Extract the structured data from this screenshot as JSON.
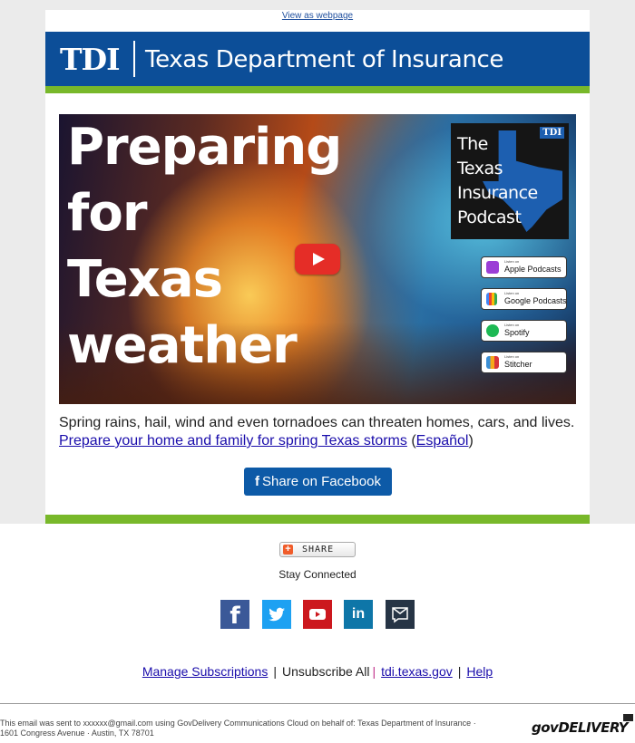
{
  "header": {
    "view_as_webpage": "View as webpage",
    "logo_text": "TDI",
    "org_name": "Texas Department of Insurance",
    "brand_color": "#0c4e98",
    "accent_color": "#78b82a"
  },
  "hero": {
    "title_lines": [
      "Preparing",
      "for",
      "Texas",
      "weather"
    ],
    "play_icon": "youtube-play-icon",
    "podcast": {
      "badge": "TDI",
      "title_lines": [
        "The",
        "Texas",
        "Insurance",
        "Podcast"
      ],
      "platforms": [
        {
          "small": "Listen on",
          "name": "Apple Podcasts"
        },
        {
          "small": "Listen on",
          "name": "Google Podcasts"
        },
        {
          "small": "Listen on",
          "name": "Spotify"
        },
        {
          "small": "Listen on",
          "name": "Stitcher"
        }
      ]
    }
  },
  "body": {
    "intro": "Spring rains, hail, wind and even tornadoes can threaten homes, cars, and lives.",
    "link_main": "Prepare your home and family for spring Texas storms",
    "open_paren": " (",
    "link_spanish": "Español",
    "close_paren": ")",
    "fb_icon": "f",
    "fb_share_label": "Share on Facebook"
  },
  "footer": {
    "share_label": "SHARE",
    "stay_connected": "Stay Connected",
    "social": [
      {
        "name": "facebook",
        "color": "#3b5998",
        "glyph": "f"
      },
      {
        "name": "twitter",
        "color": "#1da1f2",
        "glyph": "t"
      },
      {
        "name": "youtube",
        "color": "#cc181e",
        "glyph": "▶"
      },
      {
        "name": "linkedin",
        "color": "#0e76a8",
        "glyph": "in"
      },
      {
        "name": "email",
        "color": "#263445",
        "glyph": "✉"
      }
    ],
    "links": {
      "manage": "Manage Subscriptions",
      "sep1": "|",
      "unsubscribe": "Unsubscribe All",
      "sep2": "|",
      "site": "tdi.texas.gov",
      "sep3": "|",
      "help": "Help"
    },
    "note_line1": "This email was sent to xxxxxx@gmail.com using GovDelivery Communications Cloud on behalf of: Texas Department of Insurance ·",
    "note_line2": "1601 Congress Avenue · Austin, TX 78701",
    "govdelivery_logo": "govDELIVERY"
  }
}
